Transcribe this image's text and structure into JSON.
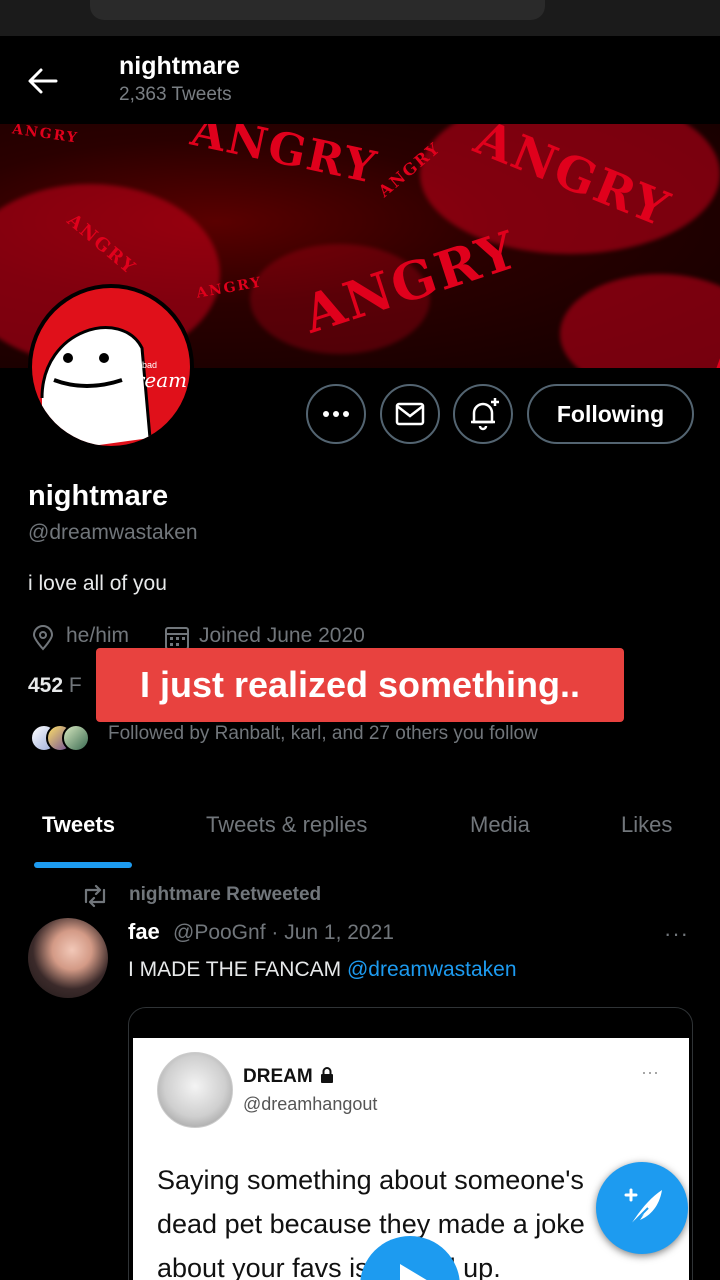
{
  "header": {
    "name": "nightmare",
    "tweet_count": "2,363 Tweets"
  },
  "banner": {
    "words": [
      "ANGRY",
      "ANGRY",
      "ANGRY",
      "ANGRY",
      "ANGRY",
      "ANGRY",
      "ANGRY",
      "ANGRY"
    ]
  },
  "avatar": {
    "badge_small": "bad",
    "badge_text": "dream"
  },
  "actions": {
    "following_label": "Following"
  },
  "profile": {
    "name": "nightmare",
    "handle": "@dreamwastaken",
    "bio": "i love all of you",
    "pronouns": "he/him",
    "joined": "Joined June 2020",
    "following_count": "452",
    "following_partial": "F"
  },
  "caption": "I just realized something..",
  "followed_by": "Followed by Ranbalt, karl, and 27 others you follow",
  "tabs": [
    {
      "label": "Tweets"
    },
    {
      "label": "Tweets & replies"
    },
    {
      "label": "Media"
    },
    {
      "label": "Likes"
    }
  ],
  "tweet": {
    "retweeted_by": "nightmare Retweeted",
    "author_name": "fae",
    "author_meta": "@PooGnf · Jun 1, 2021",
    "more": "···",
    "text": "I MADE THE FANCAM ",
    "mention": "@dreamwastaken",
    "embedded": {
      "name": "DREAM",
      "handle": "@dreamhangout",
      "more": "···",
      "line1": "Saying something about someone's",
      "line2": "dead pet because they made a joke",
      "line3": "about your favs is fucked up."
    }
  },
  "colors": {
    "accent": "#1d9bf0",
    "caption_bg": "#e8423f",
    "banner_red": "#e0001c"
  }
}
